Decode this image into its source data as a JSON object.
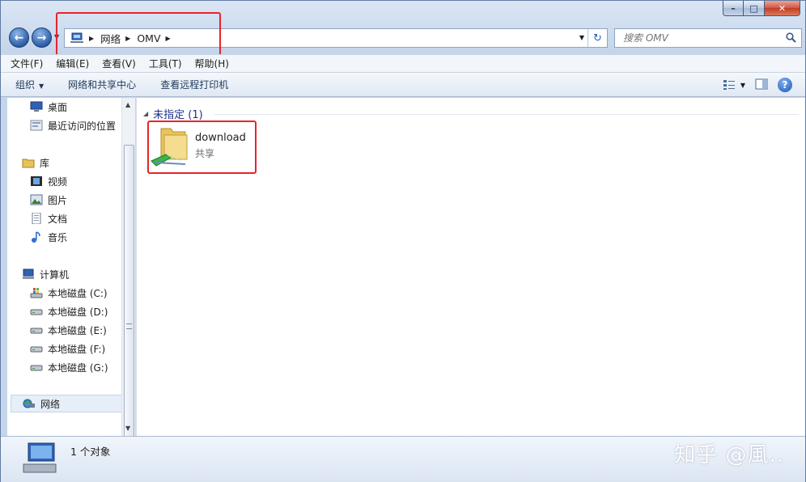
{
  "window": {
    "caption": {
      "minimize": "–",
      "maximize": "□",
      "close": "✕"
    }
  },
  "nav": {
    "back_icon": "arrow-left-icon",
    "forward_icon": "arrow-right-icon"
  },
  "address": {
    "crumbs": [
      "网络",
      "OMV"
    ]
  },
  "search": {
    "placeholder": "搜索 OMV"
  },
  "menubar": {
    "items": [
      "文件(F)",
      "编辑(E)",
      "查看(V)",
      "工具(T)",
      "帮助(H)"
    ]
  },
  "commandbar": {
    "organize": "组织",
    "network_center": "网络和共享中心",
    "remote_printers": "查看远程打印机"
  },
  "navpane": {
    "favorites": [
      {
        "label": "桌面",
        "icon": "desktop-icon"
      },
      {
        "label": "最近访问的位置",
        "icon": "recent-places-icon"
      }
    ],
    "libraries": {
      "label": "库",
      "items": [
        {
          "label": "视频",
          "icon": "video-icon"
        },
        {
          "label": "图片",
          "icon": "picture-icon"
        },
        {
          "label": "文档",
          "icon": "document-icon"
        },
        {
          "label": "音乐",
          "icon": "music-icon"
        }
      ]
    },
    "computer": {
      "label": "计算机",
      "drives": [
        "本地磁盘 (C:)",
        "本地磁盘 (D:)",
        "本地磁盘 (E:)",
        "本地磁盘 (F:)",
        "本地磁盘 (G:)"
      ]
    },
    "network": {
      "label": "网络"
    }
  },
  "content": {
    "group_label": "未指定 (1)",
    "items": [
      {
        "name": "download",
        "subtitle": "共享",
        "icon": "shared-folder-icon"
      }
    ]
  },
  "status": {
    "text": "1 个对象"
  },
  "watermark": "知乎 @風..",
  "colors": {
    "highlight": "#e8242a",
    "group_header": "#1e3287"
  }
}
